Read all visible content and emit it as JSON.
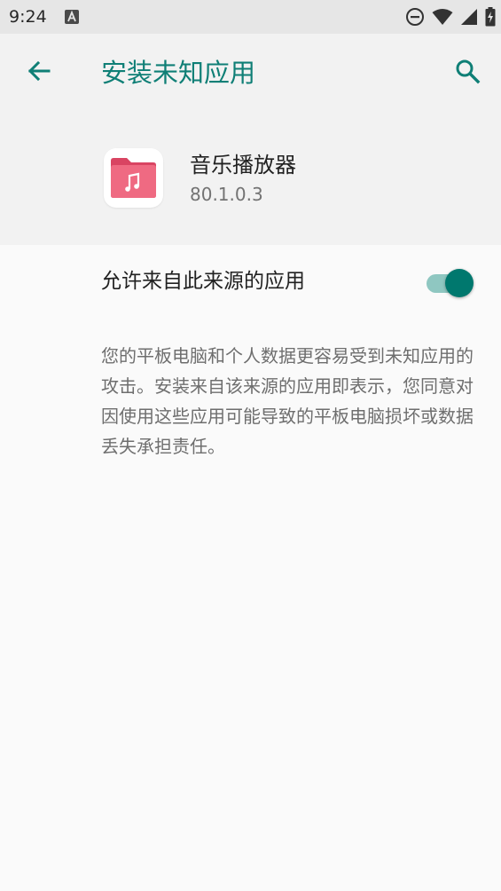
{
  "status_bar": {
    "time": "9:24",
    "icons": [
      "notification-a-icon",
      "do-not-disturb-icon",
      "wifi-icon",
      "signal-icon",
      "battery-charging-icon"
    ]
  },
  "header": {
    "title": "安装未知应用",
    "back_icon": "arrow-back-icon",
    "search_icon": "search-icon"
  },
  "app": {
    "name": "音乐播放器",
    "version": "80.1.0.3",
    "icon": "music-folder-icon"
  },
  "setting": {
    "label": "允许来自此来源的应用",
    "enabled": true
  },
  "description": "您的平板电脑和个人数据更容易受到未知应用的攻击。安装来自该来源的应用即表示，您同意对因使用这些应用可能导致的平板电脑损坏或数据丢失承担责任。",
  "colors": {
    "accent": "#0f7f76",
    "toggle_thumb": "#00786e",
    "toggle_track": "#8fc7c1",
    "app_icon": "#e8546e"
  }
}
